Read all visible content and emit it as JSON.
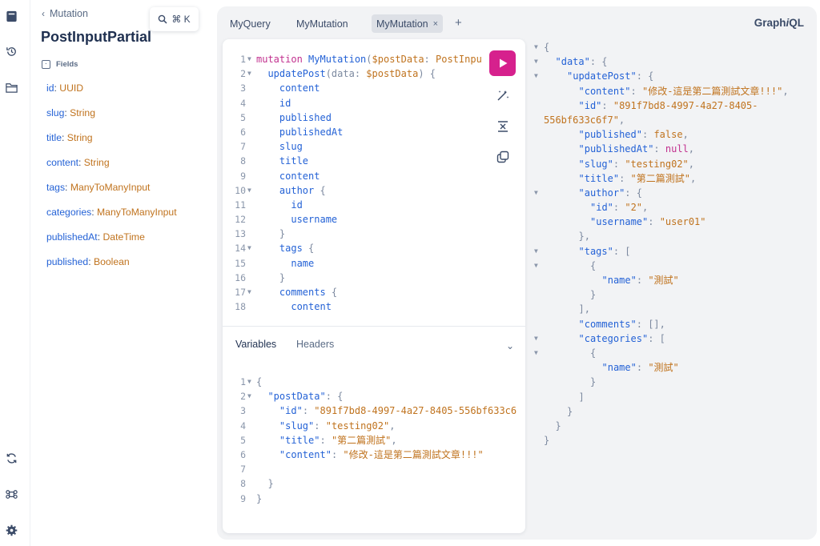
{
  "rail": {
    "icons": [
      "docs-icon",
      "history-icon",
      "explorer-icon",
      "refetch-icon",
      "shortcuts-icon",
      "settings-icon"
    ]
  },
  "docs": {
    "back_label": "Mutation",
    "title": "PostInputPartial",
    "fields_heading": "Fields",
    "search_shortcut": "⌘ K",
    "fields": [
      {
        "name": "id",
        "type": "UUID"
      },
      {
        "name": "slug",
        "type": "String"
      },
      {
        "name": "title",
        "type": "String"
      },
      {
        "name": "content",
        "type": "String"
      },
      {
        "name": "tags",
        "type": "ManyToManyInput"
      },
      {
        "name": "categories",
        "type": "ManyToManyInput"
      },
      {
        "name": "publishedAt",
        "type": "DateTime"
      },
      {
        "name": "published",
        "type": "Boolean"
      }
    ]
  },
  "tabs": [
    {
      "label": "MyQuery",
      "active": false
    },
    {
      "label": "MyMutation",
      "active": false
    },
    {
      "label": "MyMutation",
      "active": true,
      "close": "×"
    }
  ],
  "tab_add": "+",
  "brand": {
    "prefix": "Graph",
    "italic": "i",
    "suffix": "QL"
  },
  "editor": {
    "lines": [
      {
        "n": "1",
        "fold": true,
        "tokens": [
          [
            "kw",
            "mutation "
          ],
          [
            "nm",
            "MyMutation"
          ],
          [
            "pn",
            "("
          ],
          [
            "var",
            "$postData"
          ],
          [
            "pn",
            ": "
          ],
          [
            "typ",
            "PostInpu"
          ]
        ]
      },
      {
        "n": "2",
        "fold": true,
        "tokens": [
          [
            "pn",
            "  "
          ],
          [
            "fd",
            "updatePost"
          ],
          [
            "pn",
            "(data: "
          ],
          [
            "var",
            "$postData"
          ],
          [
            "pn",
            ") {"
          ]
        ]
      },
      {
        "n": "3",
        "fold": false,
        "tokens": [
          [
            "fd",
            "    content"
          ]
        ]
      },
      {
        "n": "4",
        "fold": false,
        "tokens": [
          [
            "fd",
            "    id"
          ]
        ]
      },
      {
        "n": "5",
        "fold": false,
        "tokens": [
          [
            "fd",
            "    published"
          ]
        ]
      },
      {
        "n": "6",
        "fold": false,
        "tokens": [
          [
            "fd",
            "    publishedAt"
          ]
        ]
      },
      {
        "n": "7",
        "fold": false,
        "tokens": [
          [
            "fd",
            "    slug"
          ]
        ]
      },
      {
        "n": "8",
        "fold": false,
        "tokens": [
          [
            "fd",
            "    title"
          ]
        ]
      },
      {
        "n": "9",
        "fold": false,
        "tokens": [
          [
            "fd",
            "    content"
          ]
        ]
      },
      {
        "n": "10",
        "fold": true,
        "tokens": [
          [
            "fd",
            "    author"
          ],
          [
            "pn",
            " {"
          ]
        ]
      },
      {
        "n": "11",
        "fold": false,
        "tokens": [
          [
            "fd",
            "      id"
          ]
        ]
      },
      {
        "n": "12",
        "fold": false,
        "tokens": [
          [
            "fd",
            "      username"
          ]
        ]
      },
      {
        "n": "13",
        "fold": false,
        "tokens": [
          [
            "pn",
            "    }"
          ]
        ]
      },
      {
        "n": "14",
        "fold": true,
        "tokens": [
          [
            "fd",
            "    tags"
          ],
          [
            "pn",
            " {"
          ]
        ]
      },
      {
        "n": "15",
        "fold": false,
        "tokens": [
          [
            "fd",
            "      name"
          ]
        ]
      },
      {
        "n": "16",
        "fold": false,
        "tokens": [
          [
            "pn",
            "    }"
          ]
        ]
      },
      {
        "n": "17",
        "fold": true,
        "tokens": [
          [
            "fd",
            "    comments"
          ],
          [
            "pn",
            " {"
          ]
        ]
      },
      {
        "n": "18",
        "fold": false,
        "tokens": [
          [
            "fd",
            "      content"
          ]
        ]
      }
    ]
  },
  "variables_tab": "Variables",
  "headers_tab": "Headers",
  "variables": {
    "lines": [
      {
        "n": "1",
        "fold": true,
        "tokens": [
          [
            "pn",
            "{"
          ]
        ]
      },
      {
        "n": "2",
        "fold": true,
        "tokens": [
          [
            "pn",
            "  "
          ],
          [
            "key",
            "\"postData\""
          ],
          [
            "pn",
            ": {"
          ]
        ]
      },
      {
        "n": "3",
        "fold": false,
        "tokens": [
          [
            "pn",
            "    "
          ],
          [
            "key",
            "\"id\""
          ],
          [
            "pn",
            ": "
          ],
          [
            "str",
            "\"891f7bd8-4997-4a27-8405-556bf633c6"
          ]
        ]
      },
      {
        "n": "4",
        "fold": false,
        "tokens": [
          [
            "pn",
            "    "
          ],
          [
            "key",
            "\"slug\""
          ],
          [
            "pn",
            ": "
          ],
          [
            "str",
            "\"testing02\""
          ],
          [
            "pn",
            ","
          ]
        ]
      },
      {
        "n": "5",
        "fold": false,
        "tokens": [
          [
            "pn",
            "    "
          ],
          [
            "key",
            "\"title\""
          ],
          [
            "pn",
            ": "
          ],
          [
            "str",
            "\"第二篇測試\""
          ],
          [
            "pn",
            ","
          ]
        ]
      },
      {
        "n": "6",
        "fold": false,
        "tokens": [
          [
            "pn",
            "    "
          ],
          [
            "key",
            "\"content\""
          ],
          [
            "pn",
            ": "
          ],
          [
            "str",
            "\"修改-這是第二篇測試文章!!!\""
          ]
        ]
      },
      {
        "n": "7",
        "fold": false,
        "tokens": []
      },
      {
        "n": "8",
        "fold": false,
        "tokens": [
          [
            "pn",
            "  }"
          ]
        ]
      },
      {
        "n": "9",
        "fold": false,
        "tokens": [
          [
            "pn",
            "}"
          ]
        ]
      }
    ]
  },
  "result": {
    "lines": [
      {
        "fold": true,
        "indent": 0,
        "tokens": [
          [
            "pn",
            "{"
          ]
        ]
      },
      {
        "fold": true,
        "indent": 1,
        "tokens": [
          [
            "key",
            "\"data\""
          ],
          [
            "pn",
            ": {"
          ]
        ]
      },
      {
        "fold": true,
        "indent": 2,
        "tokens": [
          [
            "key",
            "\"updatePost\""
          ],
          [
            "pn",
            ": {"
          ]
        ]
      },
      {
        "fold": false,
        "indent": 3,
        "tokens": [
          [
            "key",
            "\"content\""
          ],
          [
            "pn",
            ": "
          ],
          [
            "str",
            "\"修改-這是第二篇測試文章!!!\""
          ],
          [
            "pn",
            ","
          ]
        ]
      },
      {
        "fold": false,
        "indent": 3,
        "tokens": [
          [
            "key",
            "\"id\""
          ],
          [
            "pn",
            ": "
          ],
          [
            "str",
            "\"891f7bd8-4997-4a27-8405-"
          ]
        ]
      },
      {
        "fold": false,
        "indent": 0,
        "tokens": [
          [
            "str",
            "556bf633c6f7\""
          ],
          [
            "pn",
            ","
          ]
        ]
      },
      {
        "fold": false,
        "indent": 3,
        "tokens": [
          [
            "key",
            "\"published\""
          ],
          [
            "pn",
            ": "
          ],
          [
            "var",
            "false"
          ],
          [
            "pn",
            ","
          ]
        ]
      },
      {
        "fold": false,
        "indent": 3,
        "tokens": [
          [
            "key",
            "\"publishedAt\""
          ],
          [
            "pn",
            ": "
          ],
          [
            "kw",
            "null"
          ],
          [
            "pn",
            ","
          ]
        ]
      },
      {
        "fold": false,
        "indent": 3,
        "tokens": [
          [
            "key",
            "\"slug\""
          ],
          [
            "pn",
            ": "
          ],
          [
            "str",
            "\"testing02\""
          ],
          [
            "pn",
            ","
          ]
        ]
      },
      {
        "fold": false,
        "indent": 3,
        "tokens": [
          [
            "key",
            "\"title\""
          ],
          [
            "pn",
            ": "
          ],
          [
            "str",
            "\"第二篇測試\""
          ],
          [
            "pn",
            ","
          ]
        ]
      },
      {
        "fold": true,
        "indent": 3,
        "tokens": [
          [
            "key",
            "\"author\""
          ],
          [
            "pn",
            ": {"
          ]
        ]
      },
      {
        "fold": false,
        "indent": 4,
        "tokens": [
          [
            "key",
            "\"id\""
          ],
          [
            "pn",
            ": "
          ],
          [
            "str",
            "\"2\""
          ],
          [
            "pn",
            ","
          ]
        ]
      },
      {
        "fold": false,
        "indent": 4,
        "tokens": [
          [
            "key",
            "\"username\""
          ],
          [
            "pn",
            ": "
          ],
          [
            "str",
            "\"user01\""
          ]
        ]
      },
      {
        "fold": false,
        "indent": 3,
        "tokens": [
          [
            "pn",
            "},"
          ]
        ]
      },
      {
        "fold": true,
        "indent": 3,
        "tokens": [
          [
            "key",
            "\"tags\""
          ],
          [
            "pn",
            ": ["
          ]
        ]
      },
      {
        "fold": true,
        "indent": 4,
        "tokens": [
          [
            "pn",
            "{"
          ]
        ]
      },
      {
        "fold": false,
        "indent": 5,
        "tokens": [
          [
            "key",
            "\"name\""
          ],
          [
            "pn",
            ": "
          ],
          [
            "str",
            "\"測試\""
          ]
        ]
      },
      {
        "fold": false,
        "indent": 4,
        "tokens": [
          [
            "pn",
            "}"
          ]
        ]
      },
      {
        "fold": false,
        "indent": 3,
        "tokens": [
          [
            "pn",
            "],"
          ]
        ]
      },
      {
        "fold": false,
        "indent": 3,
        "tokens": [
          [
            "key",
            "\"comments\""
          ],
          [
            "pn",
            ": [],"
          ]
        ]
      },
      {
        "fold": true,
        "indent": 3,
        "tokens": [
          [
            "key",
            "\"categories\""
          ],
          [
            "pn",
            ": ["
          ]
        ]
      },
      {
        "fold": true,
        "indent": 4,
        "tokens": [
          [
            "pn",
            "{"
          ]
        ]
      },
      {
        "fold": false,
        "indent": 5,
        "tokens": [
          [
            "key",
            "\"name\""
          ],
          [
            "pn",
            ": "
          ],
          [
            "str",
            "\"測試\""
          ]
        ]
      },
      {
        "fold": false,
        "indent": 4,
        "tokens": [
          [
            "pn",
            "}"
          ]
        ]
      },
      {
        "fold": false,
        "indent": 3,
        "tokens": [
          [
            "pn",
            "]"
          ]
        ]
      },
      {
        "fold": false,
        "indent": 2,
        "tokens": [
          [
            "pn",
            "}"
          ]
        ]
      },
      {
        "fold": false,
        "indent": 1,
        "tokens": [
          [
            "pn",
            "}"
          ]
        ]
      },
      {
        "fold": false,
        "indent": 0,
        "tokens": [
          [
            "pn",
            "}"
          ]
        ]
      }
    ]
  },
  "colors": {
    "run_button": "#d6218d",
    "field_name": "#2462d6",
    "type_name": "#c0731e",
    "keyword": "#c2318f"
  }
}
